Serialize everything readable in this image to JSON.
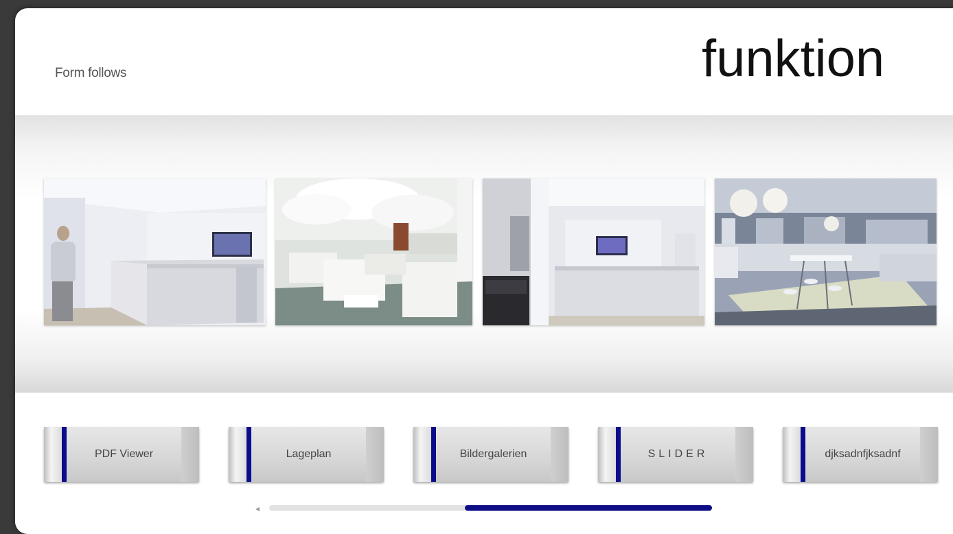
{
  "header": {
    "tagline": "Form follows",
    "title": "funktion"
  },
  "gallery": {
    "images": [
      {
        "name": "reception-desk-with-person"
      },
      {
        "name": "lounge-with-white-sofas"
      },
      {
        "name": "reception-desk-dark-chair"
      },
      {
        "name": "office-with-standing-tables"
      }
    ]
  },
  "nav": {
    "buttons": [
      {
        "label": "PDF Viewer"
      },
      {
        "label": "Lageplan"
      },
      {
        "label": "Bildergalerien"
      },
      {
        "label": "SLIDER"
      },
      {
        "label": "djksadnfjksadnf"
      }
    ]
  },
  "scrollbar": {
    "arrow": "◂",
    "position": 0.44
  },
  "colors": {
    "accent": "#0a0c8c",
    "background": "#3a3a3a"
  }
}
